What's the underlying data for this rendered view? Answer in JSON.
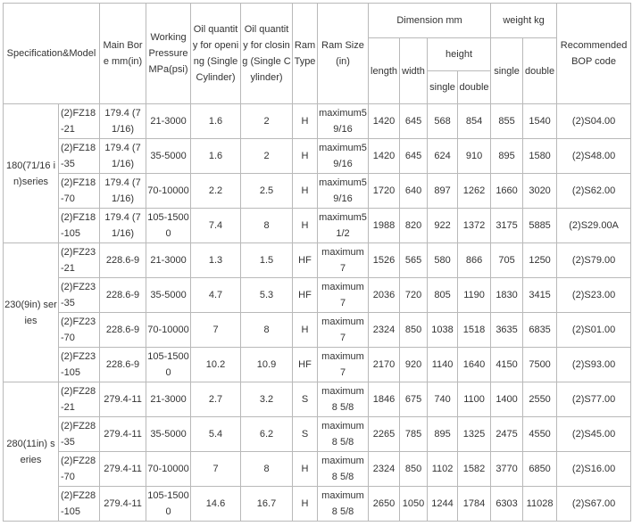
{
  "header": {
    "spec_model": "Specification&Model",
    "main_bore": "Main Bore mm(in)",
    "working_pressure": "Working Pressure MPa(psi)",
    "oil_opening": "Oil quantity for opening (Single Cylinder)",
    "oil_closing": "Oil quantity for closing (Single Cylinder)",
    "ram_type": "Ram Type",
    "ram_size": "Ram Size (in)",
    "dimension": "Dimension mm",
    "length": "length",
    "width": "width",
    "height": "height",
    "height_single": "single",
    "height_double": "double",
    "weight": "weight kg",
    "weight_single": "single",
    "weight_double": "double",
    "bop_code": "Recommended BOP code"
  },
  "groups": [
    {
      "series": "180(71/16 in)series",
      "rows": [
        {
          "model": "(2)FZ18-21",
          "bore": "179.4 (71/16)",
          "pressure": "21-3000",
          "oil_open": "1.6",
          "oil_close": "2",
          "ram_type": "H",
          "ram_size": "maximum5 9/16",
          "length": "1420",
          "width": "645",
          "h_single": "568",
          "h_double": "854",
          "w_single": "855",
          "w_double": "1540",
          "bop": "(2)S04.00"
        },
        {
          "model": "(2)FZ18-35",
          "bore": "179.4 (71/16)",
          "pressure": "35-5000",
          "oil_open": "1.6",
          "oil_close": "2",
          "ram_type": "H",
          "ram_size": "maximum5 9/16",
          "length": "1420",
          "width": "645",
          "h_single": "624",
          "h_double": "910",
          "w_single": "895",
          "w_double": "1580",
          "bop": "(2)S48.00"
        },
        {
          "model": "(2)FZ18-70",
          "bore": "179.4 (71/16)",
          "pressure": "70-10000",
          "oil_open": "2.2",
          "oil_close": "2.5",
          "ram_type": "H",
          "ram_size": "maximum5 9/16",
          "length": "1720",
          "width": "640",
          "h_single": "897",
          "h_double": "1262",
          "w_single": "1660",
          "w_double": "3020",
          "bop": "(2)S62.00"
        },
        {
          "model": "(2)FZ18-105",
          "bore": "179.4 (71/16)",
          "pressure": "105-15000",
          "oil_open": "7.4",
          "oil_close": "8",
          "ram_type": "H",
          "ram_size": "maximum5 1/2",
          "length": "1988",
          "width": "820",
          "h_single": "922",
          "h_double": "1372",
          "w_single": "3175",
          "w_double": "5885",
          "bop": "(2)S29.00A"
        }
      ]
    },
    {
      "series": "230(9in) series",
      "rows": [
        {
          "model": "(2)FZ23-21",
          "bore": "228.6-9",
          "pressure": "21-3000",
          "oil_open": "1.3",
          "oil_close": "1.5",
          "ram_type": "HF",
          "ram_size": "maximum 7",
          "length": "1526",
          "width": "565",
          "h_single": "580",
          "h_double": "866",
          "w_single": "705",
          "w_double": "1250",
          "bop": "(2)S79.00"
        },
        {
          "model": "(2)FZ23-35",
          "bore": "228.6-9",
          "pressure": "35-5000",
          "oil_open": "4.7",
          "oil_close": "5.3",
          "ram_type": "HF",
          "ram_size": "maximum 7",
          "length": "2036",
          "width": "720",
          "h_single": "805",
          "h_double": "1190",
          "w_single": "1830",
          "w_double": "3415",
          "bop": "(2)S23.00"
        },
        {
          "model": "(2)FZ23-70",
          "bore": "228.6-9",
          "pressure": "70-10000",
          "oil_open": "7",
          "oil_close": "8",
          "ram_type": "H",
          "ram_size": "maximum 7",
          "length": "2324",
          "width": "850",
          "h_single": "1038",
          "h_double": "1518",
          "w_single": "3635",
          "w_double": "6835",
          "bop": "(2)S01.00"
        },
        {
          "model": "(2)FZ23-105",
          "bore": "228.6-9",
          "pressure": "105-15000",
          "oil_open": "10.2",
          "oil_close": "10.9",
          "ram_type": "HF",
          "ram_size": "maximum 7",
          "length": "2170",
          "width": "920",
          "h_single": "1140",
          "h_double": "1640",
          "w_single": "4150",
          "w_double": "7500",
          "bop": "(2)S93.00"
        }
      ]
    },
    {
      "series": "280(11in) series",
      "rows": [
        {
          "model": "(2)FZ28-21",
          "bore": "279.4-11",
          "pressure": "21-3000",
          "oil_open": "2.7",
          "oil_close": "3.2",
          "ram_type": "S",
          "ram_size": "maximum 8 5/8",
          "length": "1846",
          "width": "675",
          "h_single": "740",
          "h_double": "1100",
          "w_single": "1400",
          "w_double": "2550",
          "bop": "(2)S77.00"
        },
        {
          "model": "(2)FZ28-35",
          "bore": "279.4-11",
          "pressure": "35-5000",
          "oil_open": "5.4",
          "oil_close": "6.2",
          "ram_type": "S",
          "ram_size": "maximum 8 5/8",
          "length": "2265",
          "width": "785",
          "h_single": "895",
          "h_double": "1325",
          "w_single": "2475",
          "w_double": "4550",
          "bop": "(2)S45.00"
        },
        {
          "model": "(2)FZ28-70",
          "bore": "279.4-11",
          "pressure": "70-10000",
          "oil_open": "7",
          "oil_close": "8",
          "ram_type": "H",
          "ram_size": "maximum 8 5/8",
          "length": "2324",
          "width": "850",
          "h_single": "1102",
          "h_double": "1582",
          "w_single": "3770",
          "w_double": "6850",
          "bop": "(2)S16.00"
        },
        {
          "model": "(2)FZ28-105",
          "bore": "279.4-11",
          "pressure": "105-15000",
          "oil_open": "14.6",
          "oil_close": "16.7",
          "ram_type": "H",
          "ram_size": "maximum 8 5/8",
          "length": "2650",
          "width": "1050",
          "h_single": "1244",
          "h_double": "1784",
          "w_single": "6303",
          "w_double": "11028",
          "bop": "(2)S67.00"
        }
      ]
    }
  ]
}
